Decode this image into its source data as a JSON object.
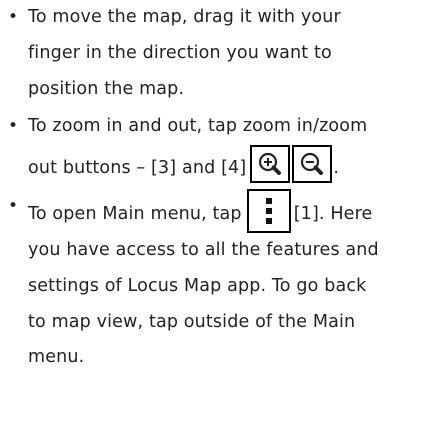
{
  "bullets": [
    {
      "line1": "To move the map, drag it with your",
      "line2": "finger in the direction you want to",
      "line3": "position the map."
    },
    {
      "line1": "To zoom in and out, tap zoom in/zoom",
      "line2_before": "out buttons – [3] and [4]",
      "line2_after": "."
    },
    {
      "line1_before": "To open Main menu, tap",
      "line1_after": "[1]. Here",
      "line2": "you have access to all the features and",
      "line3": "settings of Locus Map app. To go back",
      "line4": "to map view, tap outside of the Main",
      "line5": "menu."
    }
  ],
  "bullet_glyph": "•",
  "icons": {
    "zoom_in": "zoom-in-icon",
    "zoom_out": "zoom-out-icon",
    "menu": "menu-dots-icon"
  },
  "colors": {
    "text": "#222222",
    "icon_border": "#000000"
  }
}
